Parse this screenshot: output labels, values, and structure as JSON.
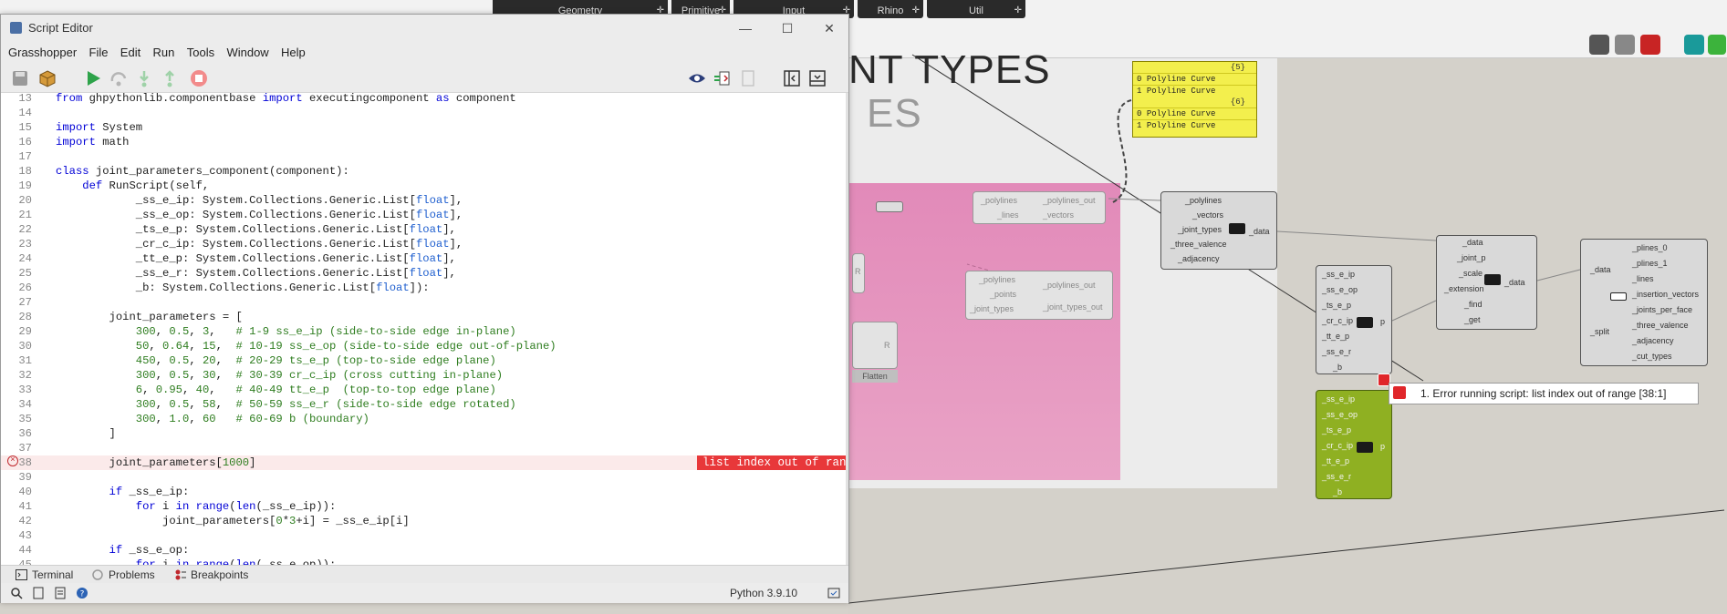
{
  "grasshopper": {
    "ribbon_tabs": [
      {
        "label": "Geometry"
      },
      {
        "label": "Primitive"
      },
      {
        "label": "Input"
      },
      {
        "label": "Rhino"
      },
      {
        "label": "Util"
      }
    ],
    "canvas_title_1": "NT TYPES",
    "canvas_title_2": "ES",
    "panel": {
      "groups": [
        {
          "header": "{5}",
          "rows": [
            {
              "index": "0",
              "value": "Polyline Curve"
            },
            {
              "index": "1",
              "value": "Polyline Curve"
            }
          ]
        },
        {
          "header": "{6}",
          "rows": [
            {
              "index": "0",
              "value": "Polyline Curve"
            },
            {
              "index": "1",
              "value": "Polyline Curve"
            }
          ]
        }
      ]
    },
    "comp_polylines_out": {
      "inputs": [
        "_polylines",
        "_lines"
      ],
      "outputs": [
        "_polylines_out",
        "_vectors"
      ]
    },
    "comp_joint_types": {
      "inputs": [
        "_polylines",
        "_points",
        "_joint_types"
      ],
      "outputs": [
        "_polylines_out",
        "_joint_types_out"
      ]
    },
    "comp_flatten": {
      "label": "Flatten",
      "port": "R",
      "port_r": "R"
    },
    "comp_data": {
      "inputs": [
        "_polylines",
        "_vectors",
        "_joint_types",
        "_three_valence",
        "_adjacency"
      ],
      "output": "_data"
    },
    "comp_params_grey": {
      "inputs": [
        "_ss_e_ip",
        "_ss_e_op",
        "_ts_e_p",
        "_cr_c_ip",
        "_tt_e_p",
        "_ss_e_r",
        "_b"
      ],
      "output": "p"
    },
    "comp_params_green": {
      "inputs": [
        "_ss_e_ip",
        "_ss_e_op",
        "_ts_e_p",
        "_cr_c_ip",
        "_tt_e_p",
        "_ss_e_r",
        "_b"
      ],
      "output": "p"
    },
    "comp_scale": {
      "inputs": [
        "_data",
        "_joint_p",
        "_scale",
        "_extension",
        "_find",
        "_get"
      ],
      "output": "_data"
    },
    "comp_plines": {
      "inputs": [
        "_data",
        "_split"
      ],
      "outputs": [
        "_plines_0",
        "_plines_1",
        "_lines",
        "_insertion_vectors",
        "_joints_per_face",
        "_three_valence",
        "_adjacency",
        "_cut_types"
      ]
    },
    "error_message": "1. Error running script: list index out of range [38:1]"
  },
  "editor": {
    "window_title": "Script Editor",
    "menu": [
      "Grasshopper",
      "File",
      "Edit",
      "Run",
      "Tools",
      "Window",
      "Help"
    ],
    "lines": [
      {
        "n": "13",
        "t": "from ghpythonlib.componentbase import executingcomponent as component"
      },
      {
        "n": "14",
        "t": ""
      },
      {
        "n": "15",
        "t": "import System"
      },
      {
        "n": "16",
        "t": "import math"
      },
      {
        "n": "17",
        "t": ""
      },
      {
        "n": "18",
        "t": "class joint_parameters_component(component):"
      },
      {
        "n": "19",
        "t": "    def RunScript(self,"
      },
      {
        "n": "20",
        "t": "            _ss_e_ip: System.Collections.Generic.List[float],"
      },
      {
        "n": "21",
        "t": "            _ss_e_op: System.Collections.Generic.List[float],"
      },
      {
        "n": "22",
        "t": "            _ts_e_p: System.Collections.Generic.List[float],"
      },
      {
        "n": "23",
        "t": "            _cr_c_ip: System.Collections.Generic.List[float],"
      },
      {
        "n": "24",
        "t": "            _tt_e_p: System.Collections.Generic.List[float],"
      },
      {
        "n": "25",
        "t": "            _ss_e_r: System.Collections.Generic.List[float],"
      },
      {
        "n": "26",
        "t": "            _b: System.Collections.Generic.List[float]):"
      },
      {
        "n": "27",
        "t": ""
      },
      {
        "n": "28",
        "t": "        joint_parameters = ["
      },
      {
        "n": "29",
        "t": "            300, 0.5, 3,   # 1-9 ss_e_ip (side-to-side edge in-plane)"
      },
      {
        "n": "30",
        "t": "            50, 0.64, 15,  # 10-19 ss_e_op (side-to-side edge out-of-plane)"
      },
      {
        "n": "31",
        "t": "            450, 0.5, 20,  # 20-29 ts_e_p (top-to-side edge plane)"
      },
      {
        "n": "32",
        "t": "            300, 0.5, 30,  # 30-39 cr_c_ip (cross cutting in-plane)"
      },
      {
        "n": "33",
        "t": "            6, 0.95, 40,   # 40-49 tt_e_p  (top-to-top edge plane)"
      },
      {
        "n": "34",
        "t": "            300, 0.5, 58,  # 50-59 ss_e_r (side-to-side edge rotated)"
      },
      {
        "n": "35",
        "t": "            300, 1.0, 60   # 60-69 b (boundary)"
      },
      {
        "n": "36",
        "t": "        ]"
      },
      {
        "n": "37",
        "t": ""
      },
      {
        "n": "38",
        "t": "        joint_parameters[1000]"
      },
      {
        "n": "39",
        "t": ""
      },
      {
        "n": "40",
        "t": "        if _ss_e_ip:"
      },
      {
        "n": "41",
        "t": "            for i in range(len(_ss_e_ip)):"
      },
      {
        "n": "42",
        "t": "                joint_parameters[0*3+i] = _ss_e_ip[i]"
      },
      {
        "n": "43",
        "t": ""
      },
      {
        "n": "44",
        "t": "        if _ss_e_op:"
      },
      {
        "n": "45",
        "t": "            for i in range(len(_ss_e_op)):"
      }
    ],
    "error_line_index": 25,
    "inline_error": "list index out of range",
    "panel_tabs": [
      "Terminal",
      "Problems",
      "Breakpoints"
    ],
    "python_version": "Python 3.9.10"
  }
}
